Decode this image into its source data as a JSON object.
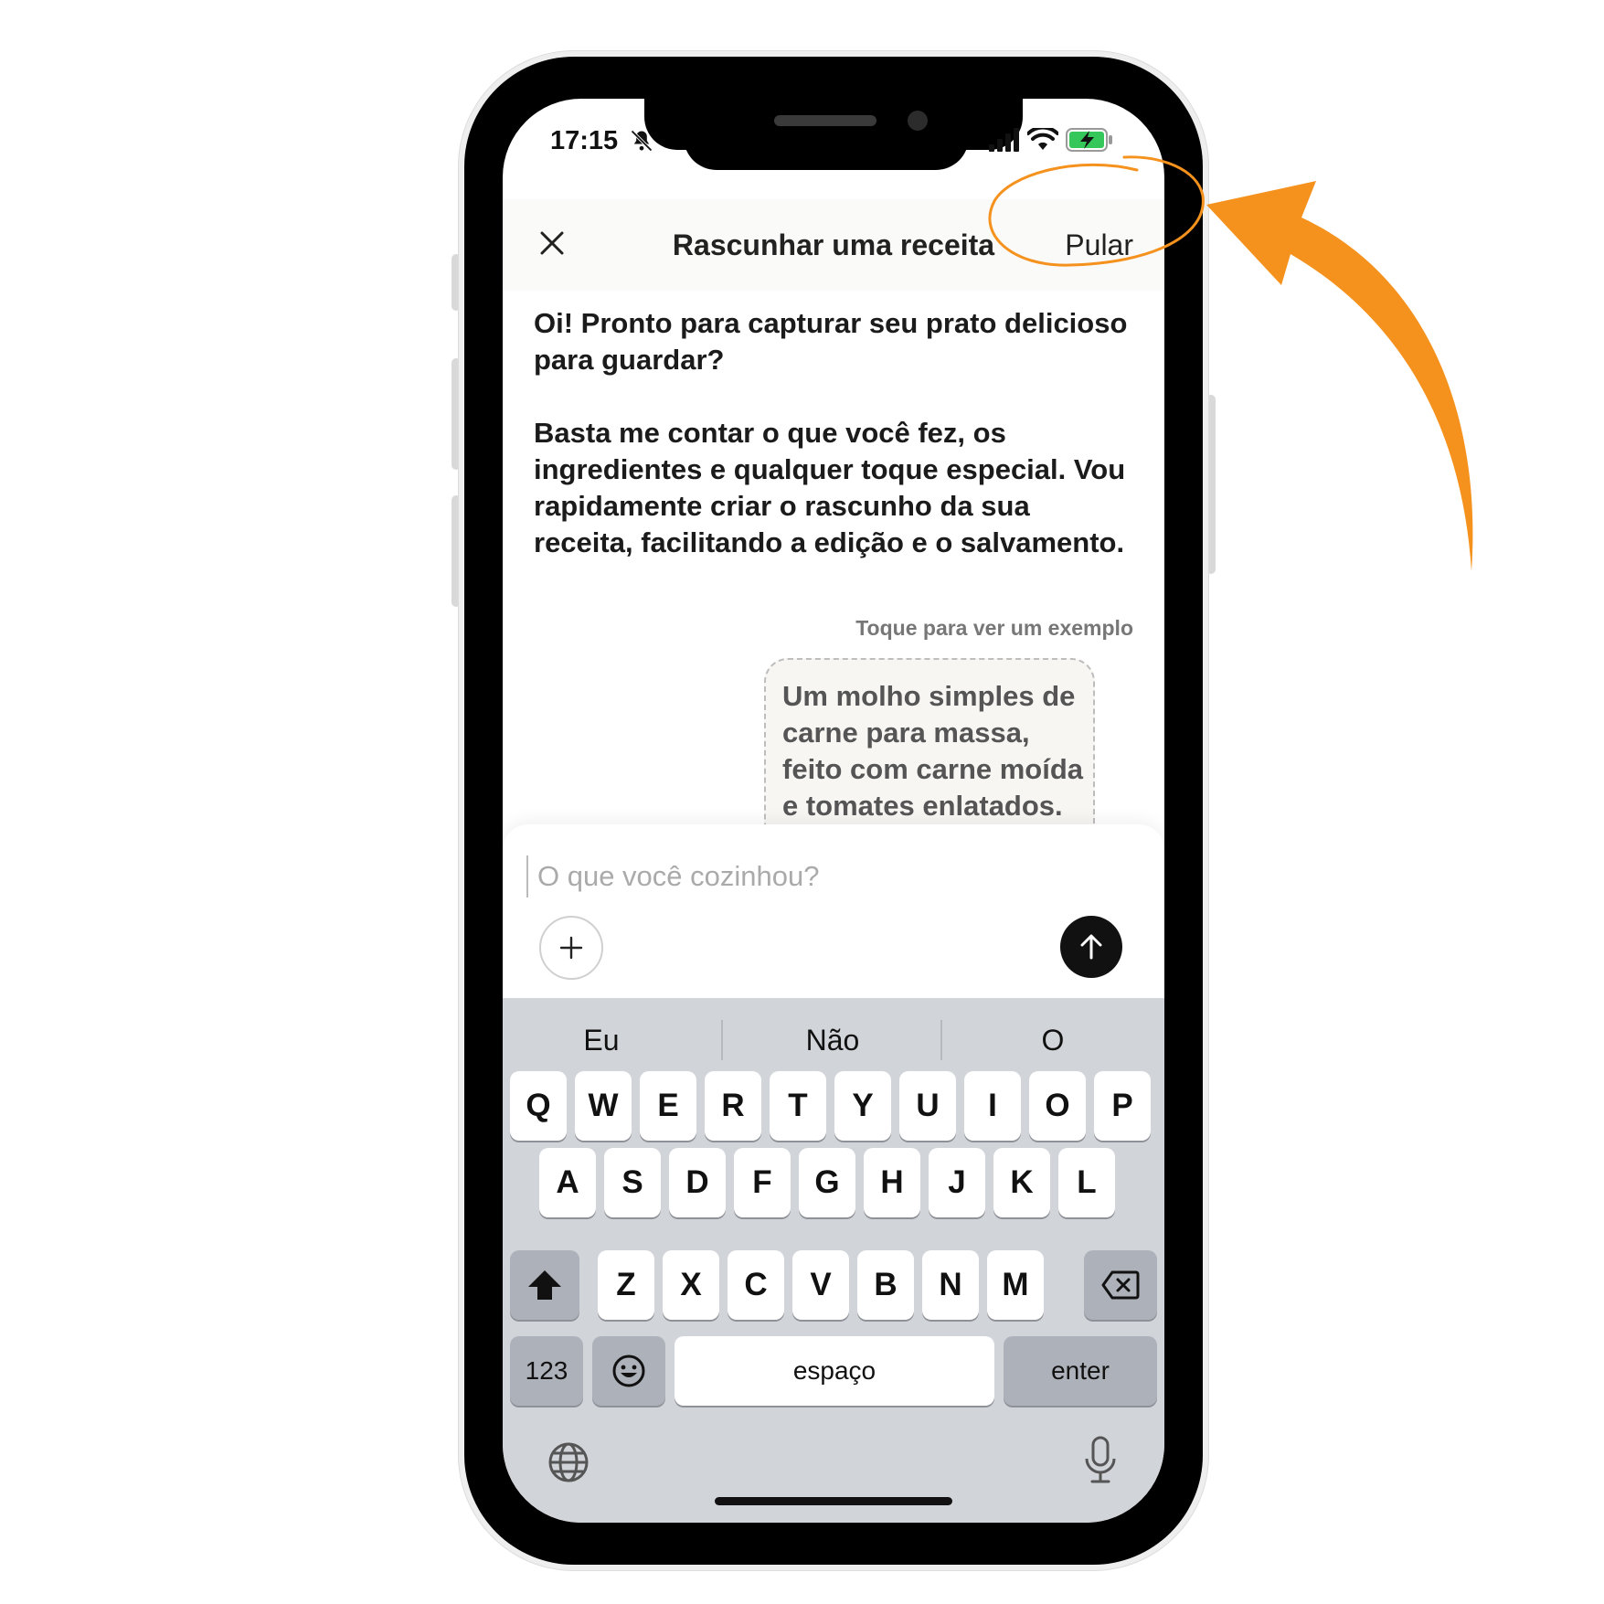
{
  "status_bar": {
    "time": "17:15"
  },
  "header": {
    "title": "Rascunhar uma receita",
    "skip_label": "Pular"
  },
  "intro": {
    "paragraph_1": "Oi! Pronto para capturar seu prato delicioso para guardar?",
    "paragraph_2": "Basta me contar o que você fez, os ingredientes e qualquer toque especial. Vou rapidamente criar o rascunho da sua receita, facilitando a edição e o salvamento."
  },
  "example": {
    "hint": "Toque para ver um exemplo",
    "text": "Um molho simples de carne para massa, feito com carne moída e tomates enlatados."
  },
  "composer": {
    "placeholder": "O que você cozinhou?"
  },
  "keyboard": {
    "suggestions": [
      "Eu",
      "Não",
      "O"
    ],
    "row1": [
      "Q",
      "W",
      "E",
      "R",
      "T",
      "Y",
      "U",
      "I",
      "O",
      "P"
    ],
    "row2": [
      "A",
      "S",
      "D",
      "F",
      "G",
      "H",
      "J",
      "K",
      "L"
    ],
    "row3": [
      "Z",
      "X",
      "C",
      "V",
      "B",
      "N",
      "M"
    ],
    "numbers_label": "123",
    "space_label": "espaço",
    "enter_label": "enter"
  },
  "colors": {
    "annotation": "#f5921e",
    "send_button": "#111111",
    "keyboard_bg": "#d1d4d9"
  },
  "icons": {
    "close": "close-icon",
    "add": "plus-icon",
    "send": "arrow-up-icon",
    "shift": "shift-icon",
    "backspace": "backspace-icon",
    "emoji": "emoji-icon",
    "globe": "globe-icon",
    "mic": "microphone-icon"
  }
}
